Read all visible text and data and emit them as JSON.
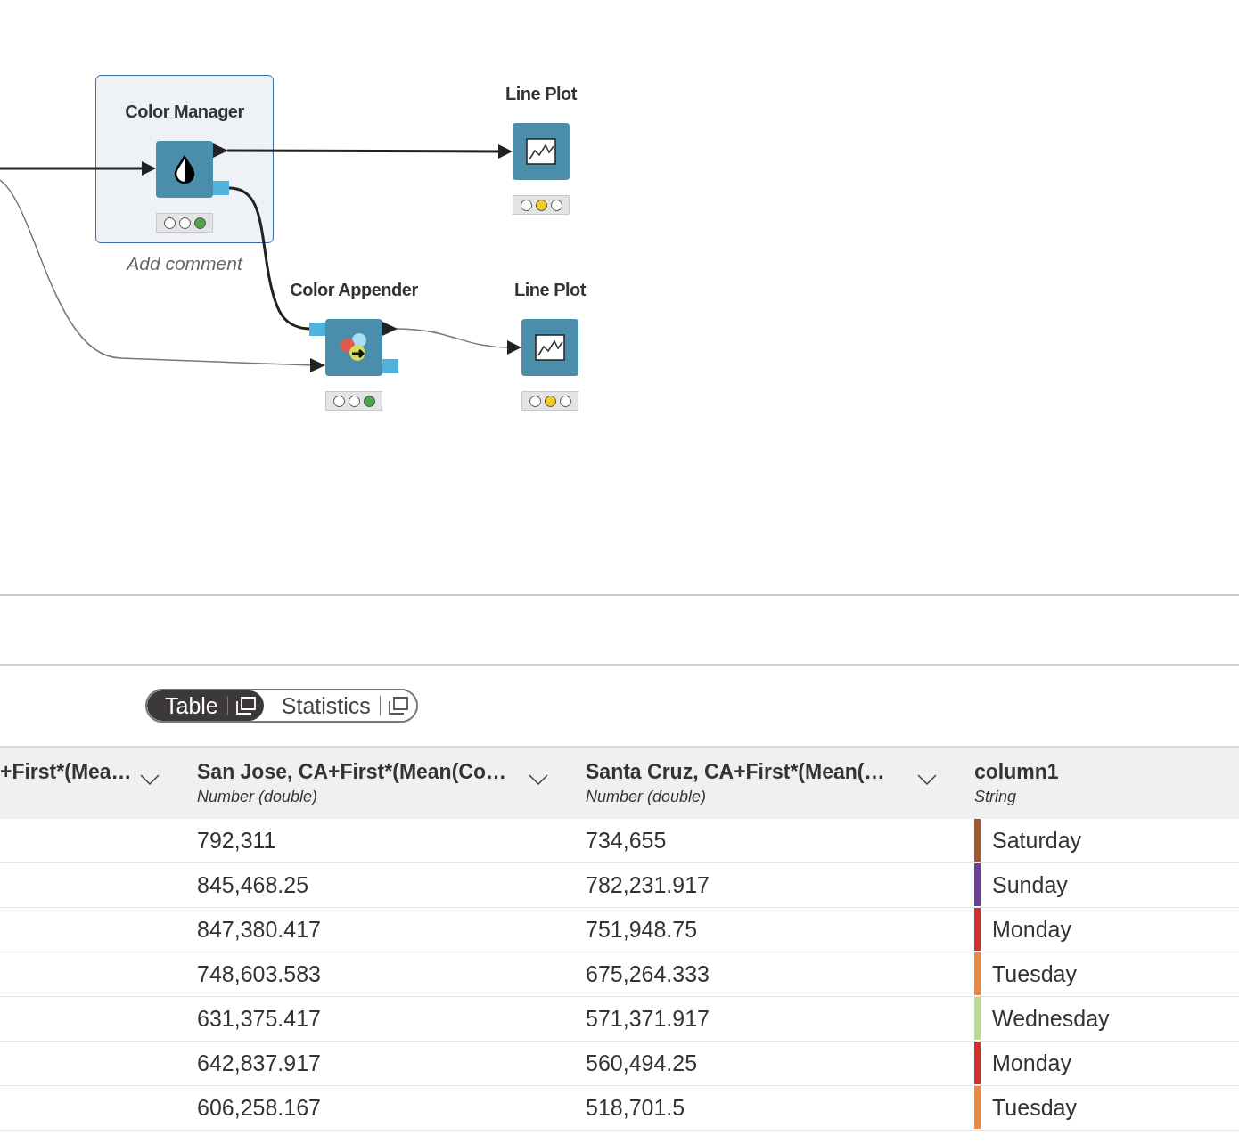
{
  "workflow": {
    "nodes": [
      {
        "name": "Color Manager",
        "kind": "color-manager",
        "executed": true,
        "selected": true,
        "comment": "Add comment"
      },
      {
        "name": "Line Plot",
        "kind": "line-plot",
        "executed": false,
        "selected": false
      },
      {
        "name": "Color Appender",
        "kind": "color-appender",
        "executed": true,
        "selected": false
      },
      {
        "name": "Line Plot",
        "kind": "line-plot",
        "executed": false,
        "selected": false
      }
    ]
  },
  "output_tabs": [
    {
      "label": "Table",
      "selected": true
    },
    {
      "label": "Statistics",
      "selected": false
    }
  ],
  "table": {
    "columns": [
      {
        "name": "+First*(Mea…"
      },
      {
        "name": "San Jose, CA+First*(Mean(Co…",
        "type": "Number (double)"
      },
      {
        "name": "Santa Cruz, CA+First*(Mean(…",
        "type": "Number (double)"
      },
      {
        "name": "column1",
        "type": "String"
      }
    ],
    "rows": [
      {
        "values": [
          "792,311",
          "734,655"
        ],
        "day": "Saturday",
        "color": "#a0582c"
      },
      {
        "values": [
          "845,468.25",
          "782,231.917"
        ],
        "day": "Sunday",
        "color": "#6a3d9a"
      },
      {
        "values": [
          "847,380.417",
          "751,948.75"
        ],
        "day": "Monday",
        "color": "#d0312d"
      },
      {
        "values": [
          "748,603.583",
          "675,264.333"
        ],
        "day": "Tuesday",
        "color": "#f0883a"
      },
      {
        "values": [
          "631,375.417",
          "571,371.917"
        ],
        "day": "Wednesday",
        "color": "#b8dc8f"
      },
      {
        "values": [
          "642,837.917",
          "560,494.25"
        ],
        "day": "Monday",
        "color": "#d0312d"
      },
      {
        "values": [
          "606,258.167",
          "518,701.5"
        ],
        "day": "Tuesday",
        "color": "#f0883a"
      }
    ]
  }
}
